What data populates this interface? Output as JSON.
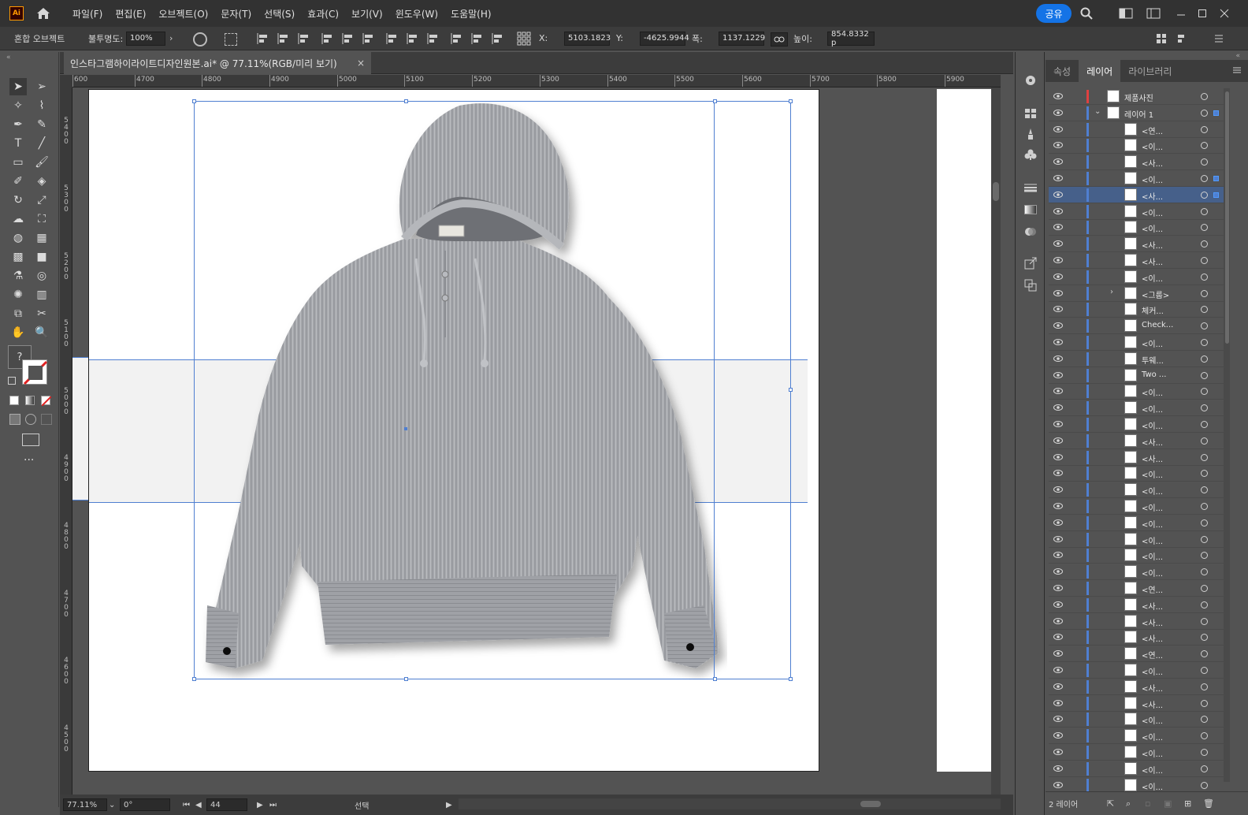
{
  "app": {
    "logo": "Ai",
    "share_label": "공유"
  },
  "menu": [
    "파일(F)",
    "편집(E)",
    "오브젝트(O)",
    "문자(T)",
    "선택(S)",
    "효과(C)",
    "보기(V)",
    "윈도우(W)",
    "도움말(H)"
  ],
  "control": {
    "object_type": "혼합 오브젝트",
    "opacity_label": "불투명도:",
    "opacity_value": "100%",
    "x_label": "X:",
    "x_value": "5103.1823",
    "y_label": "Y:",
    "y_value": "-4625.9944",
    "w_label": "폭:",
    "w_value": "1137.1229",
    "h_label": "높이:",
    "h_value": "854.8332 p"
  },
  "document": {
    "tab_title": "인스타그램하이라이트디자인원본.ai* @ 77.11%(RGB/미리 보기)",
    "close": "×"
  },
  "ruler_h": [
    {
      "label": "600",
      "pos": 0
    },
    {
      "label": "4700",
      "pos": 79
    },
    {
      "label": "4800",
      "pos": 164
    },
    {
      "label": "4900",
      "pos": 250
    },
    {
      "label": "5000",
      "pos": 336
    },
    {
      "label": "5100",
      "pos": 421
    },
    {
      "label": "5200",
      "pos": 507
    },
    {
      "label": "5300",
      "pos": 593
    },
    {
      "label": "5400",
      "pos": 679
    },
    {
      "label": "5500",
      "pos": 764
    },
    {
      "label": "5600",
      "pos": 850
    },
    {
      "label": "5700",
      "pos": 936
    },
    {
      "label": "5800",
      "pos": 1021
    },
    {
      "label": "5900",
      "pos": 1107
    }
  ],
  "ruler_v": [
    {
      "label": "5400",
      "pos": 38
    },
    {
      "label": "5300",
      "pos": 124
    },
    {
      "label": "5200",
      "pos": 210
    },
    {
      "label": "5100",
      "pos": 295
    },
    {
      "label": "5000",
      "pos": 381
    },
    {
      "label": "4900",
      "pos": 466
    },
    {
      "label": "4800",
      "pos": 552
    },
    {
      "label": "4700",
      "pos": 638
    },
    {
      "label": "4600",
      "pos": 723
    },
    {
      "label": "4500",
      "pos": 809
    }
  ],
  "status": {
    "zoom": "77.11%",
    "rotation": "0°",
    "artboard_num": "44",
    "mode": "선택"
  },
  "layers_panel": {
    "tabs": [
      "속성",
      "레이어",
      "라이브러리"
    ],
    "active_tab": 1,
    "footer_count": "2 레이어",
    "rows": [
      {
        "name": "제품사진",
        "indent": 0,
        "top": true,
        "color": "#e04040"
      },
      {
        "name": "레이어 1",
        "indent": 0,
        "top": true,
        "expanded": true,
        "selected_sq": true
      },
      {
        "name": "<연...",
        "indent": 1
      },
      {
        "name": "<이...",
        "indent": 1
      },
      {
        "name": "<사...",
        "indent": 1
      },
      {
        "name": "<이...",
        "indent": 1,
        "selected_sq": true
      },
      {
        "name": "<사...",
        "indent": 1,
        "selected": true,
        "selected_sq": true
      },
      {
        "name": "<이...",
        "indent": 1
      },
      {
        "name": "<이...",
        "indent": 1
      },
      {
        "name": "<사...",
        "indent": 1
      },
      {
        "name": "<사...",
        "indent": 1
      },
      {
        "name": "<이...",
        "indent": 1
      },
      {
        "name": "<그룹>",
        "indent": 1,
        "group": true
      },
      {
        "name": "체커...",
        "indent": 1
      },
      {
        "name": "Check...",
        "indent": 1
      },
      {
        "name": "<이...",
        "indent": 1
      },
      {
        "name": "투웨...",
        "indent": 1
      },
      {
        "name": "Two ...",
        "indent": 1
      },
      {
        "name": "<이...",
        "indent": 1
      },
      {
        "name": "<이...",
        "indent": 1
      },
      {
        "name": "<이...",
        "indent": 1
      },
      {
        "name": "<사...",
        "indent": 1
      },
      {
        "name": "<사...",
        "indent": 1
      },
      {
        "name": "<이...",
        "indent": 1
      },
      {
        "name": "<이...",
        "indent": 1
      },
      {
        "name": "<이...",
        "indent": 1
      },
      {
        "name": "<이...",
        "indent": 1
      },
      {
        "name": "<이...",
        "indent": 1
      },
      {
        "name": "<이...",
        "indent": 1
      },
      {
        "name": "<이...",
        "indent": 1
      },
      {
        "name": "<연...",
        "indent": 1
      },
      {
        "name": "<사...",
        "indent": 1
      },
      {
        "name": "<사...",
        "indent": 1
      },
      {
        "name": "<사...",
        "indent": 1
      },
      {
        "name": "<연...",
        "indent": 1
      },
      {
        "name": "<이...",
        "indent": 1
      },
      {
        "name": "<사...",
        "indent": 1
      },
      {
        "name": "<사...",
        "indent": 1
      },
      {
        "name": "<이...",
        "indent": 1
      },
      {
        "name": "<이...",
        "indent": 1
      },
      {
        "name": "<이...",
        "indent": 1
      },
      {
        "name": "<이...",
        "indent": 1
      },
      {
        "name": "<이...",
        "indent": 1
      }
    ]
  },
  "colors": {
    "selection": "#4f7fd1",
    "accent": "#1473e6",
    "red_layer": "#e04040"
  }
}
